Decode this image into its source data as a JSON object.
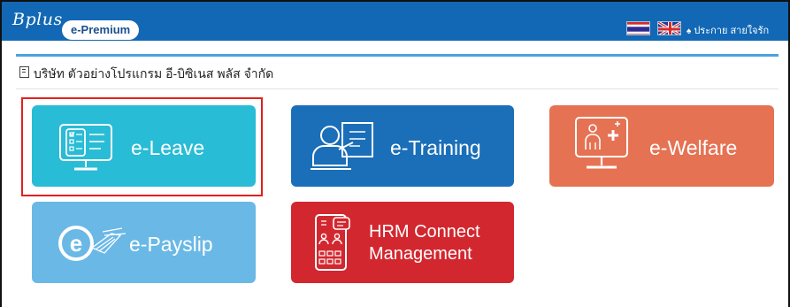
{
  "header": {
    "logo_text": "Bplus",
    "badge": "e-Premium",
    "flags": [
      "thai-flag",
      "uk-flag"
    ],
    "user_name": "ประกาย สายใจรัก"
  },
  "company": {
    "name": "บริษัท ตัวอย่างโปรแกรม อี-บิซิเนส พลัส จำกัด"
  },
  "tiles": [
    {
      "label": "e-Leave",
      "color": "#29bcd6",
      "icon": "monitor-checklist-icon",
      "selected": true
    },
    {
      "label": "e-Training",
      "color": "#1a6fb8",
      "icon": "trainer-board-icon"
    },
    {
      "label": "e-Welfare",
      "color": "#e57253",
      "icon": "monitor-health-person-icon"
    },
    {
      "label": "e-Payslip",
      "color": "#6ab8e6",
      "icon": "e-document-icon"
    },
    {
      "label_line1": "HRM Connect",
      "label_line2": "Management",
      "color": "#d3272f",
      "icon": "mobile-users-chat-icon"
    }
  ],
  "colors": {
    "topbar": "#1268b5",
    "accent_line": "#4aa3e0",
    "highlight": "#e3201b"
  }
}
